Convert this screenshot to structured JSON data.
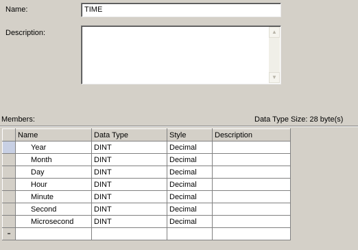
{
  "form": {
    "name_label": "Name:",
    "name_value": "TIME",
    "description_label": "Description:",
    "description_value": ""
  },
  "members": {
    "label": "Members:",
    "size_text": "Data Type Size: 28 byte(s)",
    "columns": [
      "Name",
      "Data Type",
      "Style",
      "Description"
    ],
    "rows": [
      {
        "name": "Year",
        "data_type": "DINT",
        "style": "Decimal",
        "description": ""
      },
      {
        "name": "Month",
        "data_type": "DINT",
        "style": "Decimal",
        "description": ""
      },
      {
        "name": "Day",
        "data_type": "DINT",
        "style": "Decimal",
        "description": ""
      },
      {
        "name": "Hour",
        "data_type": "DINT",
        "style": "Decimal",
        "description": ""
      },
      {
        "name": "Minute",
        "data_type": "DINT",
        "style": "Decimal",
        "description": ""
      },
      {
        "name": "Second",
        "data_type": "DINT",
        "style": "Decimal",
        "description": ""
      },
      {
        "name": "Microsecond",
        "data_type": "DINT",
        "style": "Decimal",
        "description": ""
      }
    ],
    "new_row_icon": "new-row-icon"
  }
}
